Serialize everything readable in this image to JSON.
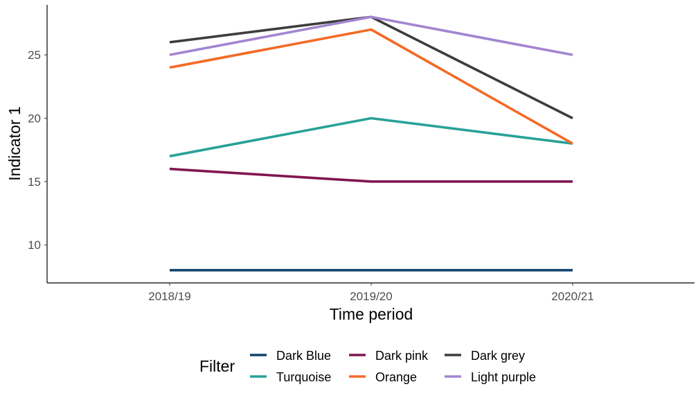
{
  "chart_data": {
    "type": "line",
    "title": "",
    "xlabel": "Time period",
    "ylabel": "Indicator 1",
    "categories": [
      "2018/19",
      "2019/20",
      "2020/21"
    ],
    "ylim": [
      7.0,
      28.95
    ],
    "yticks": [
      10,
      15,
      20,
      25
    ],
    "grid": false,
    "legend": {
      "title": "Filter",
      "position": "bottom"
    },
    "series": [
      {
        "name": "Dark Blue",
        "color": "#12436D",
        "values": [
          8,
          8,
          8
        ]
      },
      {
        "name": "Turquoise",
        "color": "#28A197",
        "values": [
          17,
          20,
          18
        ]
      },
      {
        "name": "Dark pink",
        "color": "#801650",
        "values": [
          16,
          15,
          15
        ]
      },
      {
        "name": "Orange",
        "color": "#F46A25",
        "values": [
          24,
          27,
          18
        ]
      },
      {
        "name": "Dark grey",
        "color": "#3D3D3D",
        "values": [
          26,
          28,
          20
        ]
      },
      {
        "name": "Light purple",
        "color": "#A285D1",
        "values": [
          25,
          28,
          25
        ]
      }
    ]
  }
}
